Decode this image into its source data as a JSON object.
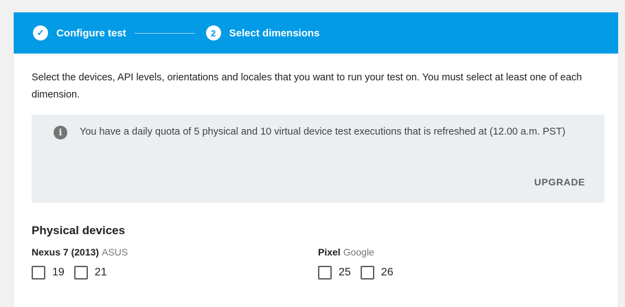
{
  "stepper": {
    "steps": [
      {
        "label": "Configure test",
        "state": "completed",
        "marker": "✓"
      },
      {
        "label": "Select dimensions",
        "state": "active",
        "marker": "2"
      }
    ]
  },
  "intro_text": "Select the devices, API levels, orientations and locales that you want to run your test on. You must select at least one of each dimension.",
  "info_box": {
    "icon": "info-icon",
    "icon_glyph": "i",
    "text": "You have a daily quota of 5 physical and 10 virtual device test executions that is refreshed at (12.00 a.m. PST)",
    "action_label": "UPGRADE"
  },
  "physical_devices": {
    "title": "Physical devices",
    "devices": [
      {
        "name": "Nexus 7 (2013)",
        "maker": "ASUS",
        "api_levels": [
          {
            "label": "19",
            "checked": false
          },
          {
            "label": "21",
            "checked": false
          }
        ]
      },
      {
        "name": "Pixel",
        "maker": "Google",
        "api_levels": [
          {
            "label": "25",
            "checked": false
          },
          {
            "label": "26",
            "checked": false
          }
        ]
      }
    ]
  },
  "colors": {
    "header_blue": "#039be5",
    "info_bg": "#eceff1",
    "page_bg": "#f1f1f1"
  }
}
